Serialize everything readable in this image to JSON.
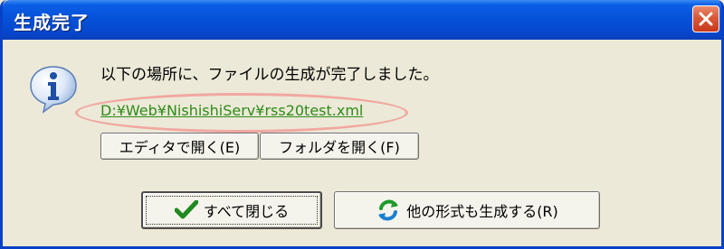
{
  "window": {
    "title": "生成完了"
  },
  "message": {
    "text": "以下の場所に、ファイルの生成が完了しました。"
  },
  "file_link": {
    "text": "D:¥Web¥NishishiServ¥rss20test.xml"
  },
  "buttons": {
    "open_editor": "エディタで開く(E)",
    "open_folder": "フォルダを開く(F)",
    "close_all": "すべて閉じる",
    "generate_other": "他の形式も生成する(R)"
  },
  "icons": {
    "info": "info-icon",
    "close": "close-icon",
    "check": "checkmark-icon",
    "refresh": "refresh-icon"
  },
  "colors": {
    "title_bar": "#0552d8",
    "close_button": "#d9583a",
    "link": "#2e8b18",
    "highlight": "#f0a8a0",
    "dialog_bg": "#ece9d8"
  }
}
